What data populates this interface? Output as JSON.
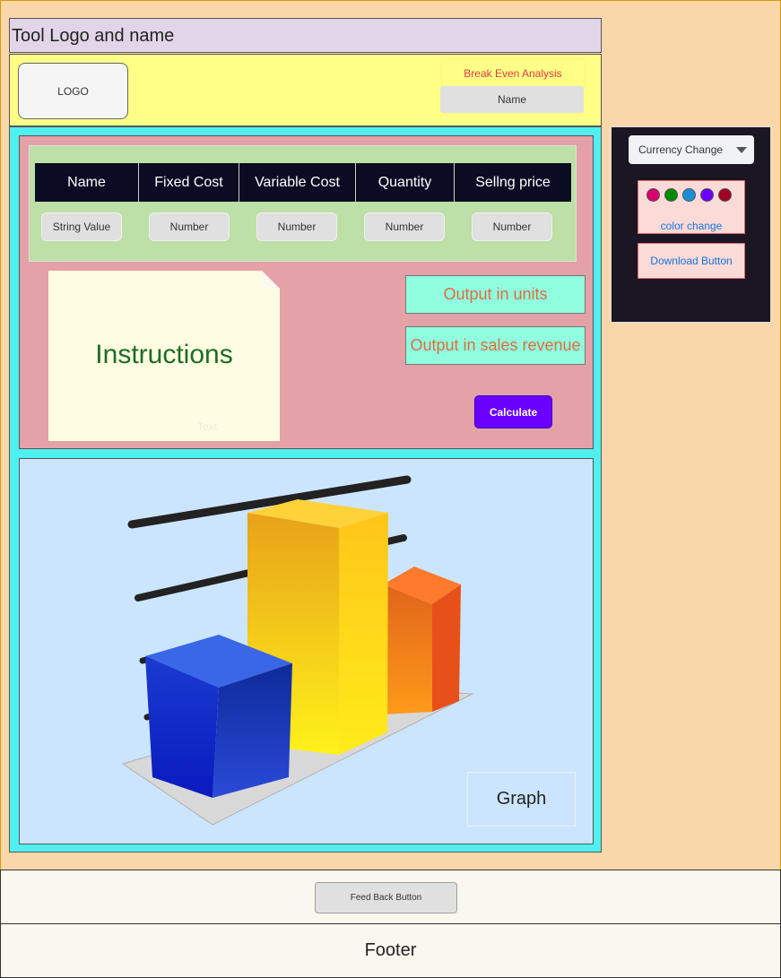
{
  "header": {
    "title": "Tool Logo and name",
    "logo_label": "LOGO",
    "app_name": "Break Even Analysis",
    "user_name": "Name"
  },
  "inputs": {
    "columns": [
      "Name",
      "Fixed Cost",
      "Variable Cost",
      "Quantity",
      "Sellng price"
    ],
    "fields": [
      "String Value",
      "Number",
      "Number",
      "Number",
      "Number"
    ]
  },
  "instructions": {
    "title": "Instructions",
    "text": "Text"
  },
  "outputs": {
    "units": "Output in units",
    "revenue": "Output in sales revenue"
  },
  "calculate_label": "Calculate",
  "graph": {
    "label": "Graph",
    "bar_colors": [
      "#1a35c8",
      "#ffc21a",
      "#f06a1a"
    ]
  },
  "side": {
    "currency_label": "Currency Change",
    "swatches": [
      "#d6006f",
      "#008a00",
      "#1b8fd6",
      "#6a00ff",
      "#a20025"
    ],
    "color_label": "color change",
    "download_label": "Download Button"
  },
  "feedback_label": "Feed Back Button",
  "footer_label": "Footer"
}
